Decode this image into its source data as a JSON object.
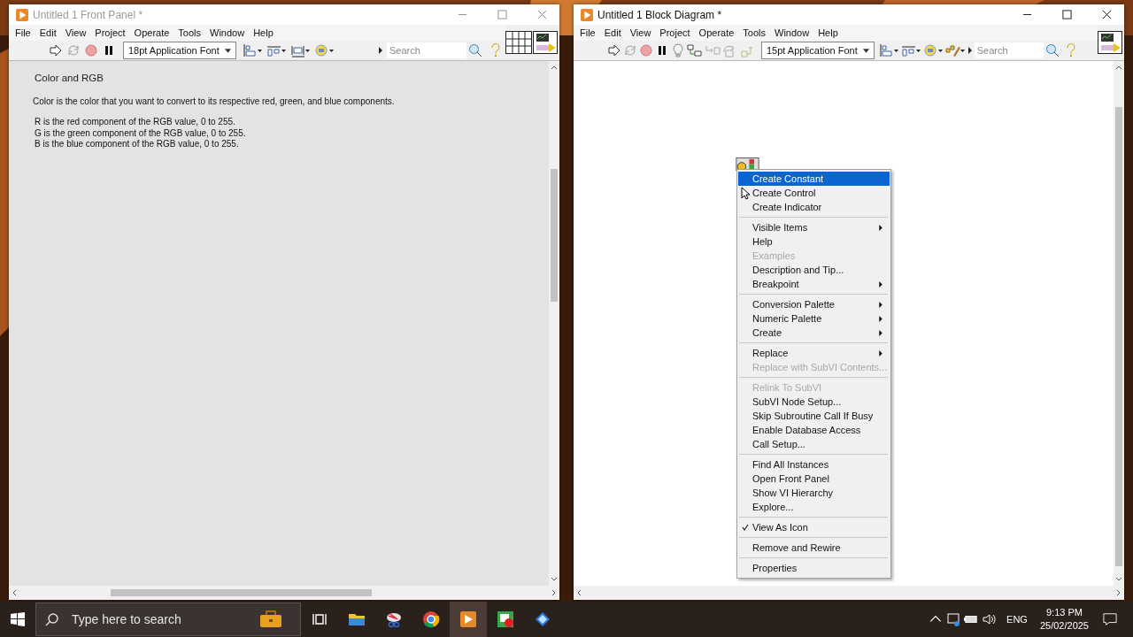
{
  "front_panel": {
    "title": "Untitled 1 Front Panel *",
    "active": false,
    "menu": [
      "File",
      "Edit",
      "View",
      "Project",
      "Operate",
      "Tools",
      "Window",
      "Help"
    ],
    "toolbar": {
      "font": "18pt Application Font",
      "search_placeholder": "Search"
    },
    "content": {
      "heading": "Color and RGB",
      "description": "Color is the color that you want to convert to its respective red, green, and blue components.",
      "lines": [
        "R is the red component of the RGB value, 0 to 255.",
        "G is the green component of the RGB value, 0 to 255.",
        "B is the blue component of the RGB value, 0 to 255."
      ]
    }
  },
  "block_diagram": {
    "title": "Untitled 1 Block Diagram *",
    "active": true,
    "menu": [
      "File",
      "Edit",
      "View",
      "Project",
      "Operate",
      "Tools",
      "Window",
      "Help"
    ],
    "toolbar": {
      "font": "15pt Application Font",
      "search_placeholder": "Search"
    },
    "context_menu": {
      "items": [
        {
          "kind": "item",
          "label": "Create Constant",
          "selected": true,
          "disabled": false,
          "checked": false,
          "submenu": false
        },
        {
          "kind": "item",
          "label": "Create Control",
          "selected": false,
          "disabled": false,
          "checked": false,
          "submenu": false
        },
        {
          "kind": "item",
          "label": "Create Indicator",
          "selected": false,
          "disabled": false,
          "checked": false,
          "submenu": false
        },
        {
          "kind": "separator"
        },
        {
          "kind": "item",
          "label": "Visible Items",
          "selected": false,
          "disabled": false,
          "checked": false,
          "submenu": true
        },
        {
          "kind": "item",
          "label": "Help",
          "selected": false,
          "disabled": false,
          "checked": false,
          "submenu": false
        },
        {
          "kind": "item",
          "label": "Examples",
          "selected": false,
          "disabled": true,
          "checked": false,
          "submenu": false
        },
        {
          "kind": "item",
          "label": "Description and Tip...",
          "selected": false,
          "disabled": false,
          "checked": false,
          "submenu": false
        },
        {
          "kind": "item",
          "label": "Breakpoint",
          "selected": false,
          "disabled": false,
          "checked": false,
          "submenu": true
        },
        {
          "kind": "separator"
        },
        {
          "kind": "item",
          "label": "Conversion Palette",
          "selected": false,
          "disabled": false,
          "checked": false,
          "submenu": true
        },
        {
          "kind": "item",
          "label": "Numeric Palette",
          "selected": false,
          "disabled": false,
          "checked": false,
          "submenu": true
        },
        {
          "kind": "item",
          "label": "Create",
          "selected": false,
          "disabled": false,
          "checked": false,
          "submenu": true
        },
        {
          "kind": "separator"
        },
        {
          "kind": "item",
          "label": "Replace",
          "selected": false,
          "disabled": false,
          "checked": false,
          "submenu": true
        },
        {
          "kind": "item",
          "label": "Replace with SubVI Contents...",
          "selected": false,
          "disabled": true,
          "checked": false,
          "submenu": false
        },
        {
          "kind": "separator"
        },
        {
          "kind": "item",
          "label": "Relink To SubVI",
          "selected": false,
          "disabled": true,
          "checked": false,
          "submenu": false
        },
        {
          "kind": "item",
          "label": "SubVI Node Setup...",
          "selected": false,
          "disabled": false,
          "checked": false,
          "submenu": false
        },
        {
          "kind": "item",
          "label": "Skip Subroutine Call If Busy",
          "selected": false,
          "disabled": false,
          "checked": false,
          "submenu": false
        },
        {
          "kind": "item",
          "label": "Enable Database Access",
          "selected": false,
          "disabled": false,
          "checked": false,
          "submenu": false
        },
        {
          "kind": "item",
          "label": "Call Setup...",
          "selected": false,
          "disabled": false,
          "checked": false,
          "submenu": false
        },
        {
          "kind": "separator"
        },
        {
          "kind": "item",
          "label": "Find All Instances",
          "selected": false,
          "disabled": false,
          "checked": false,
          "submenu": false
        },
        {
          "kind": "item",
          "label": "Open Front Panel",
          "selected": false,
          "disabled": false,
          "checked": false,
          "submenu": false
        },
        {
          "kind": "item",
          "label": "Show VI Hierarchy",
          "selected": false,
          "disabled": false,
          "checked": false,
          "submenu": false
        },
        {
          "kind": "item",
          "label": "Explore...",
          "selected": false,
          "disabled": false,
          "checked": false,
          "submenu": false
        },
        {
          "kind": "separator"
        },
        {
          "kind": "item",
          "label": "View As Icon",
          "selected": false,
          "disabled": false,
          "checked": true,
          "submenu": false
        },
        {
          "kind": "separator"
        },
        {
          "kind": "item",
          "label": "Remove and Rewire",
          "selected": false,
          "disabled": false,
          "checked": false,
          "submenu": false
        },
        {
          "kind": "separator"
        },
        {
          "kind": "item",
          "label": "Properties",
          "selected": false,
          "disabled": false,
          "checked": false,
          "submenu": false
        }
      ]
    }
  },
  "taskbar": {
    "search_placeholder": "Type here to search",
    "language": "ENG",
    "time": "9:13 PM",
    "date": "25/02/2025"
  }
}
